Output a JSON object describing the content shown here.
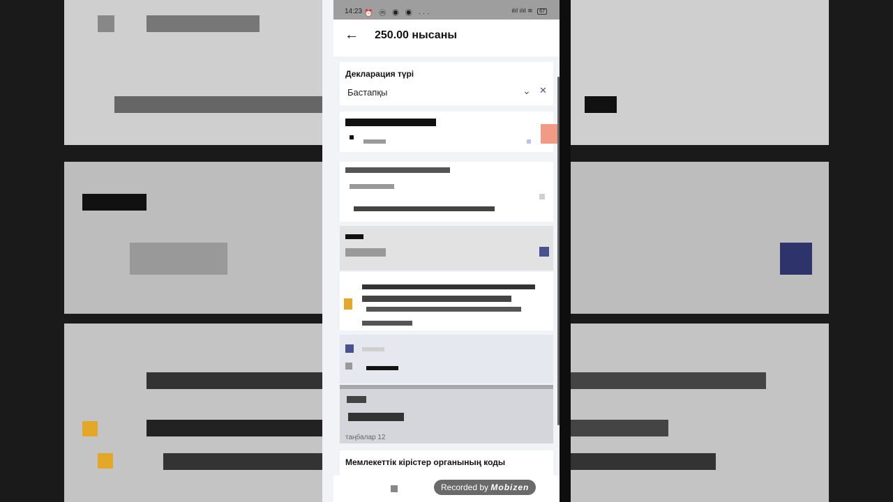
{
  "statusbar": {
    "time": "14:23",
    "icons_left": "⏰ ⓜ ◉ ◉ ···",
    "icons_right": "ılıl ılıl ≋",
    "battery": "67"
  },
  "appbar": {
    "title": "250.00 нысаны",
    "back_icon": "arrow-left-icon"
  },
  "declaration": {
    "label": "Декларация түрі",
    "value": "Бастапқы"
  },
  "selected_card": {
    "caption": "таңбалар 12"
  },
  "org_code": {
    "label": "Мемлекеттік кірістер органының коды"
  },
  "watermark": {
    "prefix": "Recorded by",
    "brand": "Mobizen"
  },
  "colors": {
    "accent": "#4a5190",
    "selected_bg": "#d5d6dc",
    "info_bg": "#e6e8ef"
  }
}
